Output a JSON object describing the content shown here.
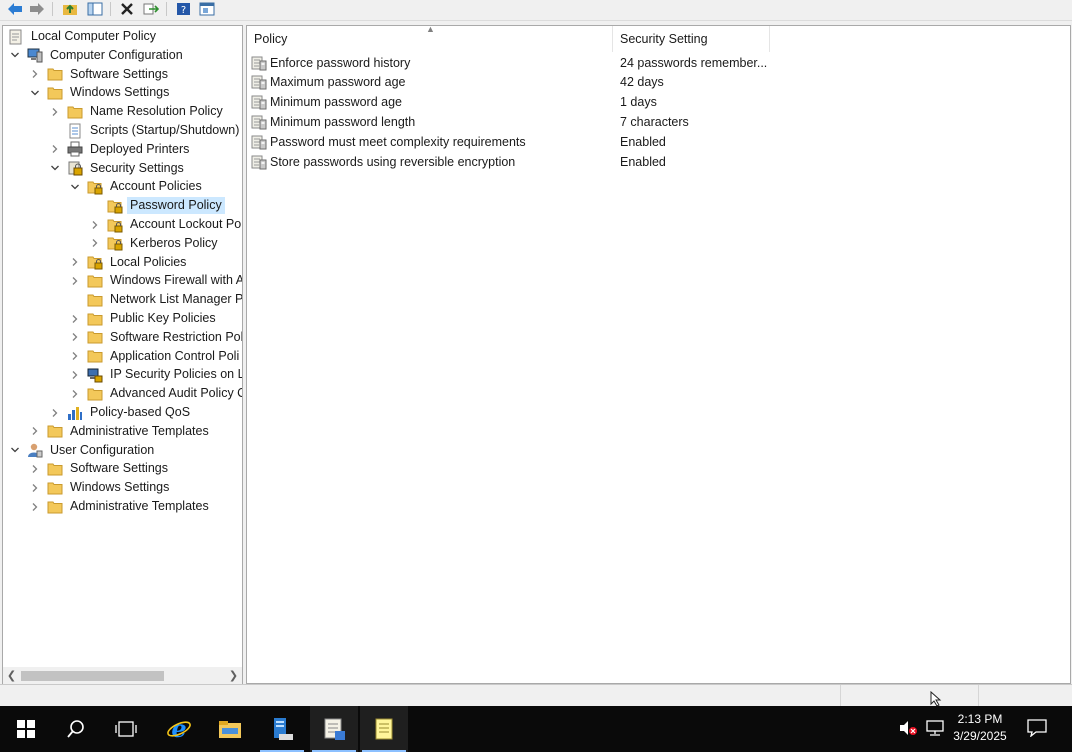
{
  "tree": {
    "nodes": [
      {
        "label": "Local Computer Policy",
        "indent": 0,
        "exp": "",
        "icon": "policy-doc-icon"
      },
      {
        "label": "Computer Configuration",
        "indent": 0,
        "exp": "open",
        "icon": "computer-icon"
      },
      {
        "label": "Software Settings",
        "indent": 1,
        "exp": "closed",
        "icon": "folder-icon"
      },
      {
        "label": "Windows Settings",
        "indent": 1,
        "exp": "open",
        "icon": "folder-icon"
      },
      {
        "label": "Name Resolution Policy",
        "indent": 2,
        "exp": "closed",
        "icon": "folder-icon"
      },
      {
        "label": "Scripts (Startup/Shutdown)",
        "indent": 2,
        "exp": "",
        "icon": "script-icon"
      },
      {
        "label": "Deployed Printers",
        "indent": 2,
        "exp": "closed",
        "icon": "printer-icon"
      },
      {
        "label": "Security Settings",
        "indent": 2,
        "exp": "open",
        "icon": "security-settings-icon"
      },
      {
        "label": "Account Policies",
        "indent": 3,
        "exp": "open",
        "icon": "lock-folder-icon"
      },
      {
        "label": "Password Policy",
        "indent": 4,
        "exp": "",
        "icon": "lock-folder-icon",
        "selected": true
      },
      {
        "label": "Account Lockout Po",
        "indent": 4,
        "exp": "closed",
        "icon": "lock-folder-icon"
      },
      {
        "label": "Kerberos Policy",
        "indent": 4,
        "exp": "closed",
        "icon": "lock-folder-icon"
      },
      {
        "label": "Local Policies",
        "indent": 3,
        "exp": "closed",
        "icon": "lock-folder-icon"
      },
      {
        "label": "Windows Firewall with A",
        "indent": 3,
        "exp": "closed",
        "icon": "folder-icon"
      },
      {
        "label": "Network List Manager P",
        "indent": 3,
        "exp": "",
        "icon": "folder-icon"
      },
      {
        "label": "Public Key Policies",
        "indent": 3,
        "exp": "closed",
        "icon": "folder-icon"
      },
      {
        "label": "Software Restriction Poli",
        "indent": 3,
        "exp": "closed",
        "icon": "folder-icon"
      },
      {
        "label": "Application Control Poli",
        "indent": 3,
        "exp": "closed",
        "icon": "folder-icon"
      },
      {
        "label": "IP Security Policies on Lo",
        "indent": 3,
        "exp": "closed",
        "icon": "ip-security-icon"
      },
      {
        "label": "Advanced Audit Policy C",
        "indent": 3,
        "exp": "closed",
        "icon": "folder-icon"
      },
      {
        "label": "Policy-based QoS",
        "indent": 2,
        "exp": "closed",
        "icon": "qos-chart-icon"
      },
      {
        "label": "Administrative Templates",
        "indent": 1,
        "exp": "closed",
        "icon": "folder-icon"
      },
      {
        "label": "User Configuration",
        "indent": 0,
        "exp": "open",
        "icon": "user-icon"
      },
      {
        "label": "Software Settings",
        "indent": 1,
        "exp": "closed",
        "icon": "folder-icon"
      },
      {
        "label": "Windows Settings",
        "indent": 1,
        "exp": "closed",
        "icon": "folder-icon"
      },
      {
        "label": "Administrative Templates",
        "indent": 1,
        "exp": "closed",
        "icon": "folder-icon"
      }
    ]
  },
  "list": {
    "columns": [
      "Policy",
      "Security Setting"
    ],
    "rows": [
      {
        "policy": "Enforce password history",
        "setting": "24 passwords remember..."
      },
      {
        "policy": "Maximum password age",
        "setting": "42 days"
      },
      {
        "policy": "Minimum password age",
        "setting": "1 days"
      },
      {
        "policy": "Minimum password length",
        "setting": "7 characters"
      },
      {
        "policy": "Password must meet complexity requirements",
        "setting": "Enabled"
      },
      {
        "policy": "Store passwords using reversible encryption",
        "setting": "Enabled"
      }
    ]
  },
  "clock": {
    "time": "2:13 PM",
    "date": "3/29/2025"
  },
  "colors": {
    "accent": "#0078d7",
    "selection": "#cce8ff",
    "folder": "#f3c85a"
  }
}
